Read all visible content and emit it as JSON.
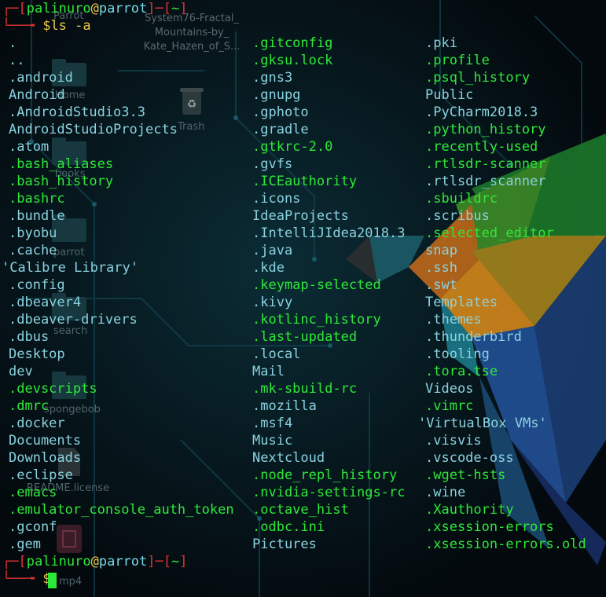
{
  "prompt": {
    "user": "palinuro",
    "at": "@",
    "host": "parrot",
    "open": "┌─[",
    "mid": "]─[",
    "path": "~",
    "close": "]",
    "corner": "└──╼ ",
    "dollar": "$",
    "command": "ls -a"
  },
  "columns": [
    [
      {
        "name": ".",
        "kind": "dir"
      },
      {
        "name": "..",
        "kind": "dir"
      },
      {
        "name": ".android",
        "kind": "dir"
      },
      {
        "name": "Android",
        "kind": "dir"
      },
      {
        "name": ".AndroidStudio3.3",
        "kind": "dir"
      },
      {
        "name": "AndroidStudioProjects",
        "kind": "dir"
      },
      {
        "name": ".atom",
        "kind": "dir"
      },
      {
        "name": ".bash_aliases",
        "kind": "file"
      },
      {
        "name": ".bash_history",
        "kind": "file"
      },
      {
        "name": ".bashrc",
        "kind": "file"
      },
      {
        "name": ".bundle",
        "kind": "dir"
      },
      {
        "name": ".byobu",
        "kind": "dir"
      },
      {
        "name": ".cache",
        "kind": "dir"
      },
      {
        "name": "'Calibre Library'",
        "kind": "dir"
      },
      {
        "name": ".config",
        "kind": "dir"
      },
      {
        "name": ".dbeaver4",
        "kind": "dir"
      },
      {
        "name": ".dbeaver-drivers",
        "kind": "dir"
      },
      {
        "name": ".dbus",
        "kind": "dir"
      },
      {
        "name": "Desktop",
        "kind": "dir"
      },
      {
        "name": "dev",
        "kind": "dir"
      },
      {
        "name": ".devscripts",
        "kind": "file"
      },
      {
        "name": ".dmrc",
        "kind": "file"
      },
      {
        "name": ".docker",
        "kind": "dir"
      },
      {
        "name": "Documents",
        "kind": "dir"
      },
      {
        "name": "Downloads",
        "kind": "dir"
      },
      {
        "name": ".eclipse",
        "kind": "dir"
      },
      {
        "name": ".emacs",
        "kind": "file"
      },
      {
        "name": ".emulator_console_auth_token",
        "kind": "file"
      },
      {
        "name": ".gconf",
        "kind": "dir"
      },
      {
        "name": ".gem",
        "kind": "dir"
      }
    ],
    [
      {
        "name": ".gitconfig",
        "kind": "file"
      },
      {
        "name": ".gksu.lock",
        "kind": "file"
      },
      {
        "name": ".gns3",
        "kind": "dir"
      },
      {
        "name": ".gnupg",
        "kind": "dir"
      },
      {
        "name": ".gphoto",
        "kind": "dir"
      },
      {
        "name": ".gradle",
        "kind": "dir"
      },
      {
        "name": ".gtkrc-2.0",
        "kind": "file"
      },
      {
        "name": ".gvfs",
        "kind": "dir"
      },
      {
        "name": ".ICEauthority",
        "kind": "file"
      },
      {
        "name": ".icons",
        "kind": "dir"
      },
      {
        "name": "IdeaProjects",
        "kind": "dir"
      },
      {
        "name": ".IntelliJIdea2018.3",
        "kind": "dir"
      },
      {
        "name": ".java",
        "kind": "dir"
      },
      {
        "name": ".kde",
        "kind": "dir"
      },
      {
        "name": ".keymap-selected",
        "kind": "file"
      },
      {
        "name": ".kivy",
        "kind": "dir"
      },
      {
        "name": ".kotlinc_history",
        "kind": "file"
      },
      {
        "name": ".last-updated",
        "kind": "file"
      },
      {
        "name": ".local",
        "kind": "dir"
      },
      {
        "name": "Mail",
        "kind": "dir"
      },
      {
        "name": ".mk-sbuild-rc",
        "kind": "file"
      },
      {
        "name": ".mozilla",
        "kind": "dir"
      },
      {
        "name": ".msf4",
        "kind": "dir"
      },
      {
        "name": "Music",
        "kind": "dir"
      },
      {
        "name": "Nextcloud",
        "kind": "dir"
      },
      {
        "name": ".node_repl_history",
        "kind": "file"
      },
      {
        "name": ".nvidia-settings-rc",
        "kind": "file"
      },
      {
        "name": ".octave_hist",
        "kind": "file"
      },
      {
        "name": ".odbc.ini",
        "kind": "file"
      },
      {
        "name": "Pictures",
        "kind": "dir"
      }
    ],
    [
      {
        "name": ".pki",
        "kind": "dir"
      },
      {
        "name": ".profile",
        "kind": "file"
      },
      {
        "name": ".psql_history",
        "kind": "file"
      },
      {
        "name": "Public",
        "kind": "dir"
      },
      {
        "name": ".PyCharm2018.3",
        "kind": "dir"
      },
      {
        "name": ".python_history",
        "kind": "file"
      },
      {
        "name": ".recently-used",
        "kind": "file"
      },
      {
        "name": ".rtlsdr-scanner",
        "kind": "file"
      },
      {
        "name": ".rtlsdr_scanner",
        "kind": "dir"
      },
      {
        "name": ".sbuildrc",
        "kind": "file"
      },
      {
        "name": ".scribus",
        "kind": "dir"
      },
      {
        "name": ".selected_editor",
        "kind": "file"
      },
      {
        "name": "snap",
        "kind": "dir"
      },
      {
        "name": ".ssh",
        "kind": "dir"
      },
      {
        "name": ".swt",
        "kind": "dir"
      },
      {
        "name": "Templates",
        "kind": "dir"
      },
      {
        "name": ".themes",
        "kind": "dir"
      },
      {
        "name": ".thunderbird",
        "kind": "dir"
      },
      {
        "name": ".tooling",
        "kind": "dir"
      },
      {
        "name": ".tora.tse",
        "kind": "file"
      },
      {
        "name": "Videos",
        "kind": "dir"
      },
      {
        "name": ".vimrc",
        "kind": "file"
      },
      {
        "name": "'VirtualBox VMs'",
        "kind": "dir"
      },
      {
        "name": ".visvis",
        "kind": "dir"
      },
      {
        "name": ".vscode-oss",
        "kind": "dir"
      },
      {
        "name": ".wget-hsts",
        "kind": "file"
      },
      {
        "name": ".wine",
        "kind": "dir"
      },
      {
        "name": ".Xauthority",
        "kind": "file"
      },
      {
        "name": ".xsession-errors",
        "kind": "file"
      },
      {
        "name": ".xsession-errors.old",
        "kind": "file"
      }
    ]
  ],
  "desktop": {
    "icons": [
      {
        "label": "Parrot"
      },
      {
        "label": "Home"
      },
      {
        "label": "Trash"
      },
      {
        "label": "books"
      },
      {
        "label": "parrot"
      },
      {
        "label": "search"
      },
      {
        "label": "spongebob"
      },
      {
        "label": "README.license"
      },
      {
        "label": "mp4"
      }
    ],
    "wallpaper_caption": [
      "System76-Fractal_",
      "Mountains-by_",
      "Kate_Hazen_of_S..."
    ]
  },
  "colors": {
    "dir": "#8ad2e0",
    "file": "#2ee838",
    "bracket": "#e03232",
    "prompt_symbol": "#e9c34a",
    "background": "#041118"
  }
}
